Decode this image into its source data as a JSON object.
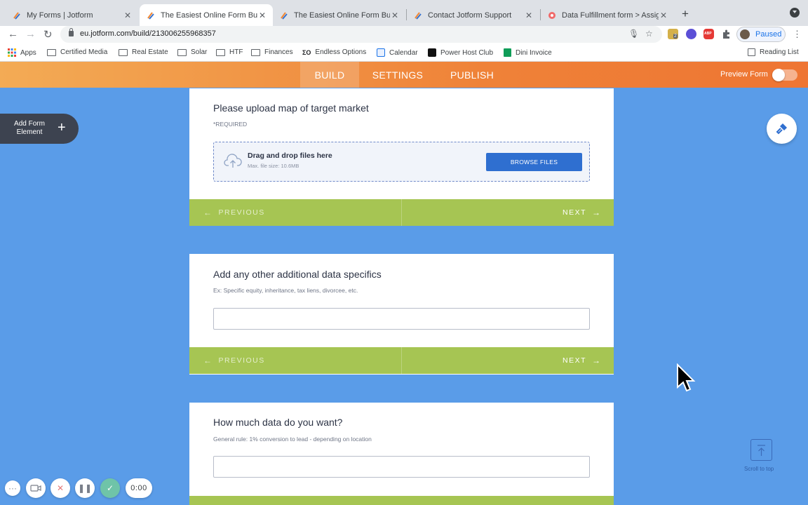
{
  "browser": {
    "tabs": [
      {
        "title": "My Forms | Jotform",
        "active": false
      },
      {
        "title": "The Easiest Online Form Builde",
        "active": true
      },
      {
        "title": "The Easiest Online Form Builde",
        "active": false
      },
      {
        "title": "Contact Jotform Support",
        "active": false
      },
      {
        "title": "Data Fulfillment form > Assign",
        "active": false
      }
    ],
    "new_tab_icon": "plus-icon",
    "url": "eu.jotform.com/build/213006255968357",
    "profile_label": "Paused",
    "extension_badge": "2",
    "abp_label": "ABP",
    "bookmarks": [
      {
        "label": "Apps",
        "icon": "apps-grid-icon"
      },
      {
        "label": "Certified Media",
        "icon": "folder-icon"
      },
      {
        "label": "Real Estate",
        "icon": "folder-icon"
      },
      {
        "label": "Solar",
        "icon": "folder-icon"
      },
      {
        "label": "HTF",
        "icon": "folder-icon"
      },
      {
        "label": "Finances",
        "icon": "folder-icon"
      },
      {
        "label": "Endless Options",
        "icon": "eo-icon"
      },
      {
        "label": "Calendar",
        "icon": "calendar-icon"
      },
      {
        "label": "Power Host Club",
        "icon": "phc-icon"
      },
      {
        "label": "Dini Invoice",
        "icon": "sheets-icon"
      }
    ],
    "reading_list": "Reading List"
  },
  "app": {
    "nav": [
      {
        "label": "BUILD",
        "active": true
      },
      {
        "label": "SETTINGS",
        "active": false
      },
      {
        "label": "PUBLISH",
        "active": false
      }
    ],
    "preview_label": "Preview Form",
    "preview_enabled": false,
    "add_element_label": "Add Form Element",
    "colors": {
      "header_start": "#f3ab55",
      "header_end": "#ee7533",
      "canvas": "#5a9ce8",
      "nav_bar": "#a6c553",
      "browse_button": "#2f6fd0"
    }
  },
  "form": {
    "upload_card": {
      "title": "Please upload map of target market",
      "required_label": "*REQUIRED",
      "drop_title": "Drag and drop files here",
      "drop_sub": "Max. file size: 10.6MB",
      "browse_label": "BROWSE FILES",
      "prev_label": "PREVIOUS",
      "next_label": "NEXT"
    },
    "specifics_card": {
      "title": "Add any other additional data specifics",
      "sublabel": "Ex: Specific equity, inheritance, tax liens, divorcee, etc.",
      "value": "",
      "prev_label": "PREVIOUS",
      "next_label": "NEXT"
    },
    "amount_card": {
      "title": "How much data do you want?",
      "sublabel": "General rule: 1% conversion to lead - depending on location",
      "value": ""
    }
  },
  "scroll_to_top_label": "Scroll to top",
  "recorder": {
    "timer": "0:00"
  }
}
